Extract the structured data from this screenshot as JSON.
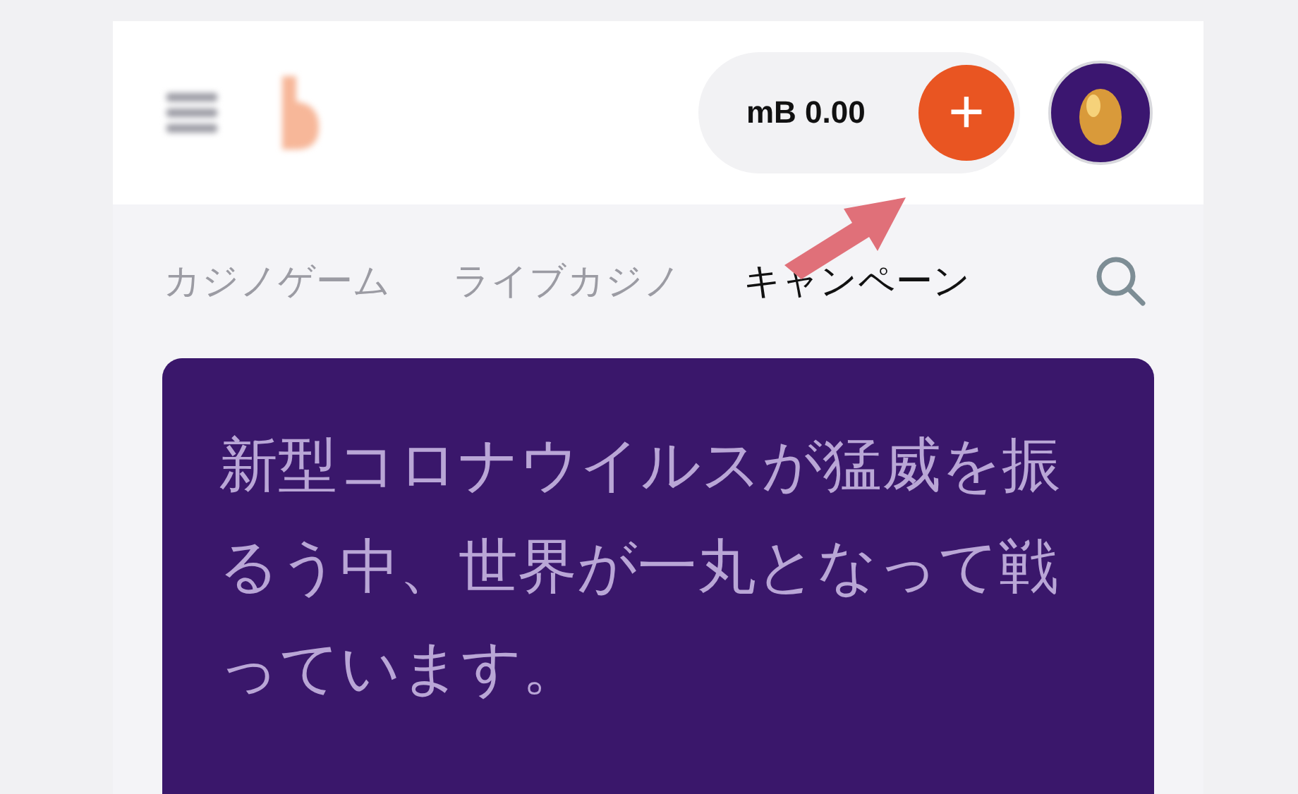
{
  "header": {
    "balance": "mB 0.00",
    "deposit_button": "+"
  },
  "nav": {
    "tabs": [
      {
        "label": "カジノゲーム",
        "selected": false
      },
      {
        "label": "ライブカジノ",
        "selected": false
      },
      {
        "label": "キャンペーン",
        "selected": true
      }
    ]
  },
  "banner": {
    "text": "新型コロナウイルスが猛威を振るう中、世界が一丸となって戦っています。"
  }
}
